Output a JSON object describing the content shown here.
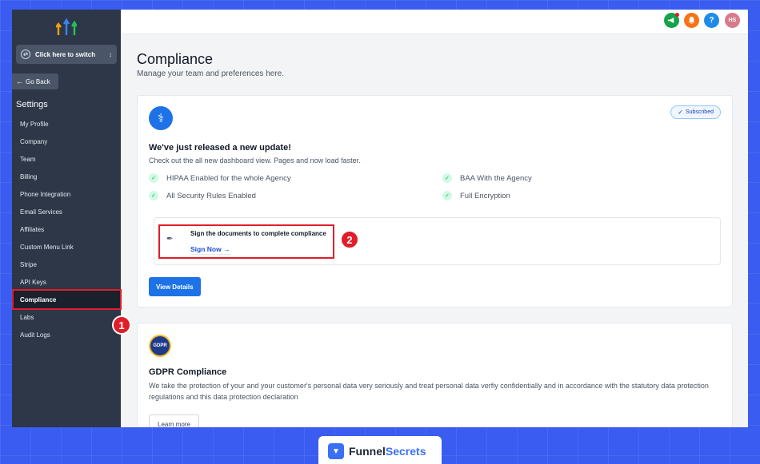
{
  "sidebar": {
    "switcher_label": "Click here to switch",
    "go_back": "Go Back",
    "settings_title": "Settings",
    "items": [
      {
        "label": "My Profile"
      },
      {
        "label": "Company"
      },
      {
        "label": "Team"
      },
      {
        "label": "Billing"
      },
      {
        "label": "Phone Integration"
      },
      {
        "label": "Email Services"
      },
      {
        "label": "Affiliates"
      },
      {
        "label": "Custom Menu Link"
      },
      {
        "label": "Stripe"
      },
      {
        "label": "API Keys"
      },
      {
        "label": "Compliance",
        "active": true
      },
      {
        "label": "Labs"
      },
      {
        "label": "Audit Logs"
      }
    ]
  },
  "topbar": {
    "icons": [
      "megaphone-icon",
      "bell-icon",
      "help-icon",
      "avatar"
    ],
    "help_glyph": "?",
    "avatar_initials": "HS",
    "colors": {
      "megaphone": "#16a34a",
      "bell": "#f97316",
      "help": "#1d8ce8",
      "avatar": "#d97a8c"
    }
  },
  "page": {
    "title": "Compliance",
    "subtitle": "Manage your team and preferences here."
  },
  "hipaa_card": {
    "badge": "Subscribed",
    "title": "We've just released a new update!",
    "subtitle": "Check out the all new dashboard view. Pages and now load faster.",
    "features": [
      "HIPAA Enabled for the whole Agency",
      "All Security Rules Enabled",
      "BAA With the Agency",
      "Full Encryption"
    ],
    "sign_text": "Sign the documents to complete compliance",
    "sign_link": "Sign Now",
    "view_details": "View Details"
  },
  "gdpr_card": {
    "icon_text": "GDPR",
    "title": "GDPR Compliance",
    "text": "We take the protection of your and your customer's personal data very seriously and treat personal data verfiy confidentially and in accordance with the statutory data protection regulations and this data protection declaration",
    "learn_more": "Learn more"
  },
  "callouts": {
    "one": "1",
    "two": "2"
  },
  "footer": {
    "brand_part1": "Funnel",
    "brand_part2": "Secrets"
  },
  "colors": {
    "accent": "#1d72e8",
    "highlight": "#e11d2a",
    "sidebar": "#2d3748"
  }
}
